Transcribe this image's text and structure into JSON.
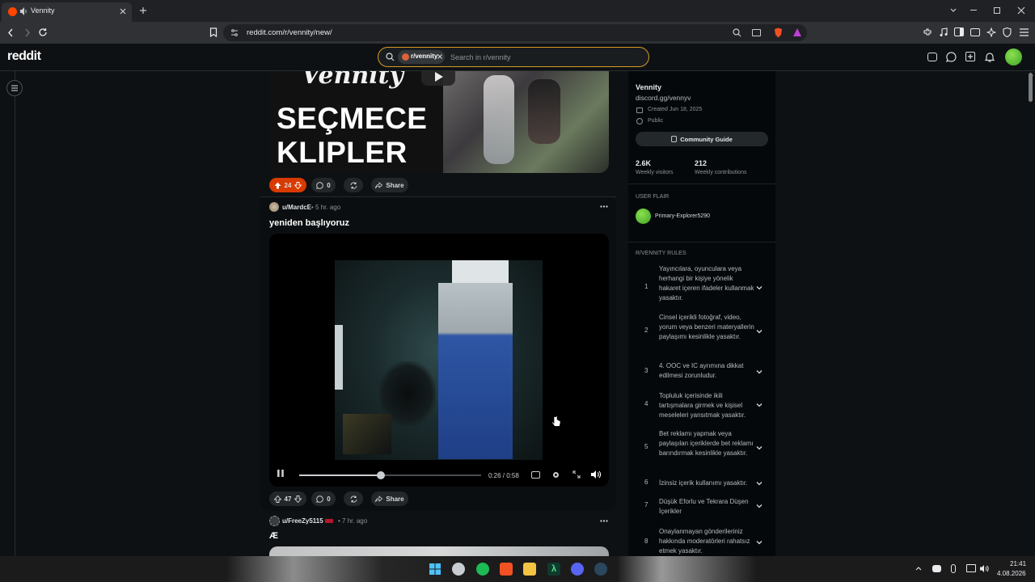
{
  "browser": {
    "tab_title": "Vennity",
    "url": "reddit.com/r/vennity/new/"
  },
  "header": {
    "logo": "reddit",
    "search_chip": "r/vennity",
    "search_placeholder": "Search in r/vennity"
  },
  "posts": [
    {
      "thumbnail_text_1": "SEÇMECE",
      "thumbnail_text_2": "KLIPLER",
      "thumbnail_brand": "Vennity",
      "votes": "24",
      "comments": "0",
      "share": "Share"
    },
    {
      "author": "u/MardcE",
      "time": "• 5 hr. ago",
      "title": "yeniden başlıyoruz",
      "video_time": "0:26 / 0:58",
      "video_progress": 0.45,
      "votes": "47",
      "comments": "0",
      "share": "Share"
    },
    {
      "author": "u/FreeZy5115",
      "time": "• 7 hr. ago",
      "title": "Æ"
    }
  ],
  "sidebar": {
    "name": "Vennity",
    "link": "discord.gg/vennyv",
    "created": "Created Jun 18, 2025",
    "visibility": "Public",
    "guide_button": "Community Guide",
    "visitors_value": "2.6K",
    "visitors_label": "Weekly visitors",
    "contrib_value": "212",
    "contrib_label": "Weekly contributions",
    "flair_heading": "USER FLAIR",
    "flair_user": "Primary-Explorer5290",
    "rules_heading": "R/VENNITY RULES",
    "rules": [
      {
        "num": "1",
        "text": "Yayıncılara, oyunculara veya herhangi bir kişiye yönelik hakaret içeren ifadeler kullanmak yasaktır."
      },
      {
        "num": "2",
        "text": "Cinsel içerikli fotoğraf, video, yorum veya benzeri materyallerin paylaşımı kesinlikle yasaktır."
      },
      {
        "num": "3",
        "text": "4. OOC ve IC ayrımına dikkat edilmesi zorunludur."
      },
      {
        "num": "4",
        "text": "Topluluk içerisinde ikili tartışmalara girmek ve kişisel meseleleri yansıtmak yasaktır."
      },
      {
        "num": "5",
        "text": "Bet reklamı yapmak veya paylaşılan içeriklerde bet reklamı barındırmak kesinlikle yasaktır."
      },
      {
        "num": "6",
        "text": "İzinsiz içerik kullanımı yasaktır."
      },
      {
        "num": "7",
        "text": "Düşük Eforlu ve Tekrara Düşen İçerikler"
      },
      {
        "num": "8",
        "text": "Onaylanmayan gönderileriniz hakkında moderatörleri rahatsız etmek yasaktır."
      }
    ]
  },
  "taskbar": {
    "time": "21:41",
    "date": "4.08.2026"
  },
  "colors": {
    "accent_orange": "#d93a00",
    "search_border": "#d49a2a",
    "background": "#0e1113"
  }
}
